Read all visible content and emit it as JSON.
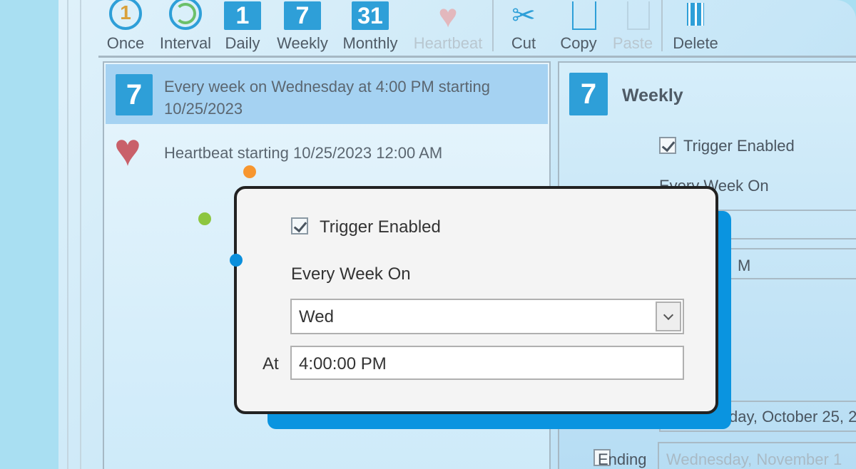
{
  "toolbar": {
    "items": [
      {
        "label": "Once",
        "icon": "once-clock-icon"
      },
      {
        "label": "Interval",
        "icon": "interval-clock-icon"
      },
      {
        "label": "Daily",
        "icon": "calendar-1-icon",
        "glyph": "1"
      },
      {
        "label": "Weekly",
        "icon": "calendar-7-icon",
        "glyph": "7"
      },
      {
        "label": "Monthly",
        "icon": "calendar-31-icon",
        "glyph": "31"
      },
      {
        "label": "Heartbeat",
        "icon": "heartbeat-icon",
        "disabled": true
      },
      {
        "label": "Cut",
        "icon": "scissors-icon"
      },
      {
        "label": "Copy",
        "icon": "copy-icon"
      },
      {
        "label": "Paste",
        "icon": "paste-icon",
        "disabled": true
      },
      {
        "label": "Delete",
        "icon": "trash-icon"
      }
    ]
  },
  "triggers": [
    {
      "text": "Every week on Wednesday at 4:00 PM starting 10/25/2023",
      "icon": "calendar-7-icon",
      "glyph": "7",
      "selected": true
    },
    {
      "text": "Heartbeat starting 10/25/2023 12:00 AM",
      "icon": "heartbeat-icon",
      "selected": false
    }
  ],
  "detail": {
    "title": "Weekly",
    "glyph": "7",
    "trigger_enabled_label": "Trigger Enabled",
    "every_week_on_label": "Every Week On",
    "time_partial": "M",
    "starting_partial": "day, October 25, 2",
    "ending_label": "Ending",
    "ending_value": "Wednesday, November 1"
  },
  "popup": {
    "trigger_enabled_label": "Trigger Enabled",
    "trigger_enabled": true,
    "every_week_on_label": "Every Week On",
    "day_value": "Wed",
    "at_label": "At",
    "time_value": "4:00:00 PM"
  },
  "colors": {
    "accent": "#2e9fd8",
    "popup_shadow": "#0a94e0",
    "selected_row": "#a5d2f2",
    "heart": "#c9606a"
  }
}
